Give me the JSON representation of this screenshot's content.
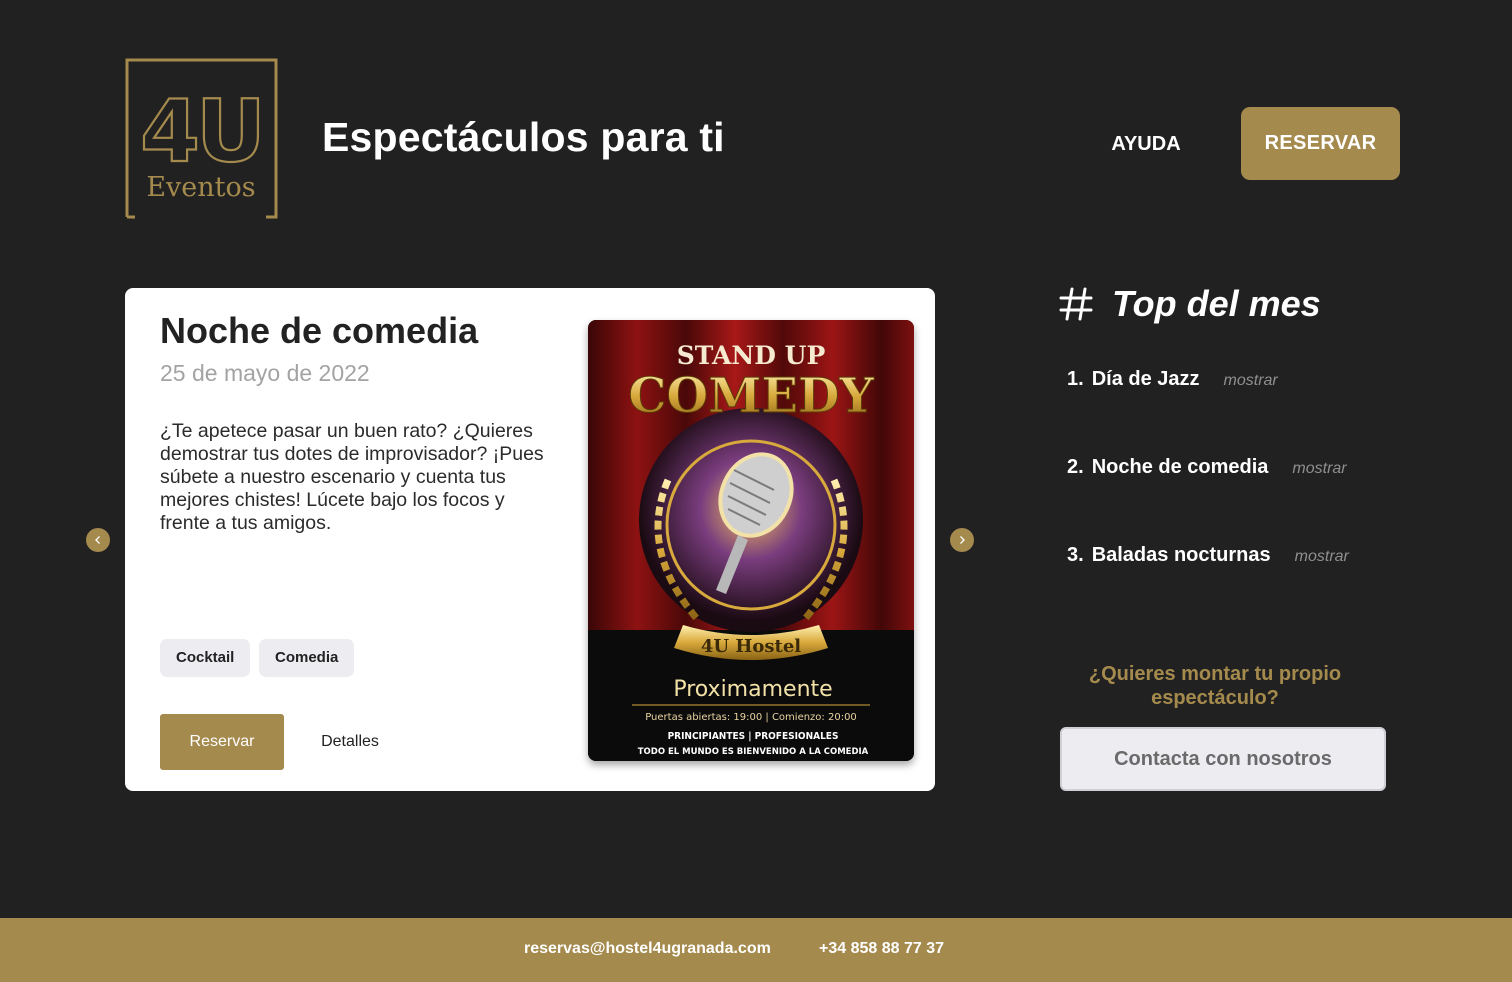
{
  "brand": {
    "logo_mark": "4U",
    "logo_text": "Eventos",
    "logo_color": "#a58a4d"
  },
  "header": {
    "title": "Espectáculos para ti",
    "help_label": "AYUDA",
    "reserve_label": "RESERVAR"
  },
  "carousel": {
    "prev_icon": "chevron-left-icon",
    "next_icon": "chevron-right-icon"
  },
  "event": {
    "title": "Noche de comedia",
    "date": "25 de mayo de 2022",
    "description": "¿Te apetece pasar un buen rato? ¿Quieres demostrar tus dotes de improvisador? ¡Pues súbete a nuestro escenario y cuenta tus mejores chistes! Lúcete bajo los focos y frente a tus amigos.",
    "tags": [
      "Cocktail",
      "Comedia"
    ],
    "reserve_label": "Reservar",
    "details_label": "Detalles",
    "poster": {
      "line1": "STAND UP",
      "line2": "COMEDY",
      "venue": "4U Hostel",
      "status": "Proximamente",
      "schedule": "Puertas abiertas: 19:00 | Comienzo: 20:00",
      "levels": "PRINCIPIANTES | PROFESIONALES",
      "welcome": "TODO EL MUNDO ES BIENVENIDO A LA COMEDIA"
    }
  },
  "top": {
    "icon": "hash-icon",
    "title": "Top del mes",
    "items": [
      {
        "num": "1.",
        "name": "Día de Jazz",
        "action": "mostrar"
      },
      {
        "num": "2.",
        "name": "Noche de comedia",
        "action": "mostrar"
      },
      {
        "num": "3.",
        "name": "Baladas nocturnas",
        "action": "mostrar"
      }
    ],
    "cta_question": "¿Quieres montar tu propio espectáculo?",
    "contact_label": "Contacta con nosotros"
  },
  "footer": {
    "email": "reservas@hostel4ugranada.com",
    "phone": "+34 858 88 77 37"
  },
  "colors": {
    "background": "#212121",
    "accent": "#a58a4d",
    "card": "#ffffff",
    "tag_bg": "#ececf1"
  }
}
